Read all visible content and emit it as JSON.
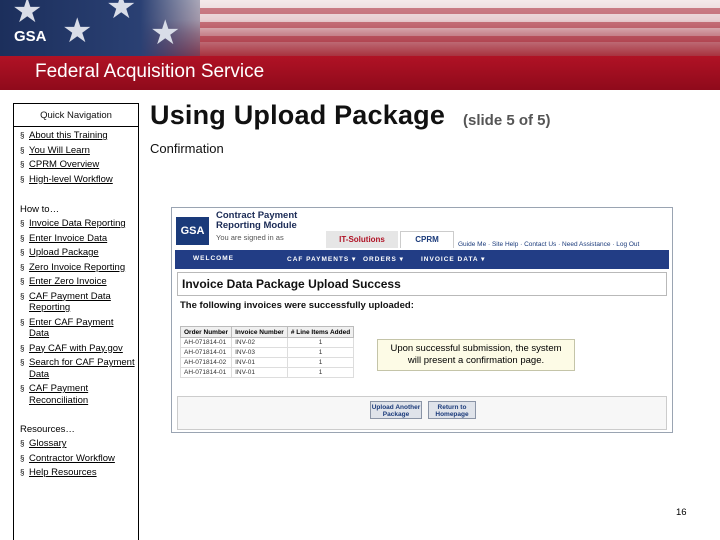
{
  "header": {
    "logo_text": "GSA",
    "banner_title": "Federal Acquisition Service"
  },
  "nav": {
    "title": "Quick Navigation",
    "intro_items": [
      "About this Training",
      "You Will Learn",
      "CPRM Overview",
      "High-level Workflow"
    ],
    "howto_heading": "How to…",
    "howto_items": [
      "Invoice Data Reporting",
      "Enter Invoice Data",
      "Upload Package",
      "Zero Invoice Reporting",
      "Enter Zero Invoice",
      "CAF Payment Data Reporting",
      "Enter CAF Payment Data",
      "Pay CAF with Pay.gov",
      "Search for CAF Payment Data",
      "CAF Payment Reconciliation"
    ],
    "resources_heading": "Resources…",
    "resources_items": [
      "Glossary",
      "Contractor Workflow",
      "Help Resources"
    ]
  },
  "main": {
    "title": "Using Upload Package",
    "slide_indicator": "(slide 5 of 5)",
    "subtitle": "Confirmation"
  },
  "screenshot": {
    "logo": "GSA",
    "module_title_line1": "Contract Payment",
    "module_title_line2": "Reporting Module",
    "signed_in": "You are signed in as",
    "tab_it": "IT-Solutions",
    "tab_cprm": "CPRM",
    "top_links": "Guide Me · Site Help · Contact Us · Need Assistance · Log Out",
    "nav_items": [
      "WELCOME",
      "CAF PAYMENTS ▾",
      "ORDERS ▾",
      "INVOICE DATA ▾"
    ],
    "panel_title": "Invoice Data Package Upload Success",
    "message": "The following invoices were successfully uploaded:",
    "table_headers": [
      "Order Number",
      "Invoice Number",
      "# Line Items Added"
    ],
    "table_rows": [
      [
        "AH-071814-01",
        "INV-02",
        "1"
      ],
      [
        "AH-071814-01",
        "INV-03",
        "1"
      ],
      [
        "AH-071814-02",
        "INV-01",
        "1"
      ],
      [
        "AH-071814-01",
        "INV-01",
        "1"
      ]
    ],
    "buttons": [
      "Upload Another Package",
      "Return to Homepage"
    ]
  },
  "callout": {
    "text_line1": "Upon successful submission, the system",
    "text_line2": "will present a confirmation page."
  },
  "page_number": "16"
}
